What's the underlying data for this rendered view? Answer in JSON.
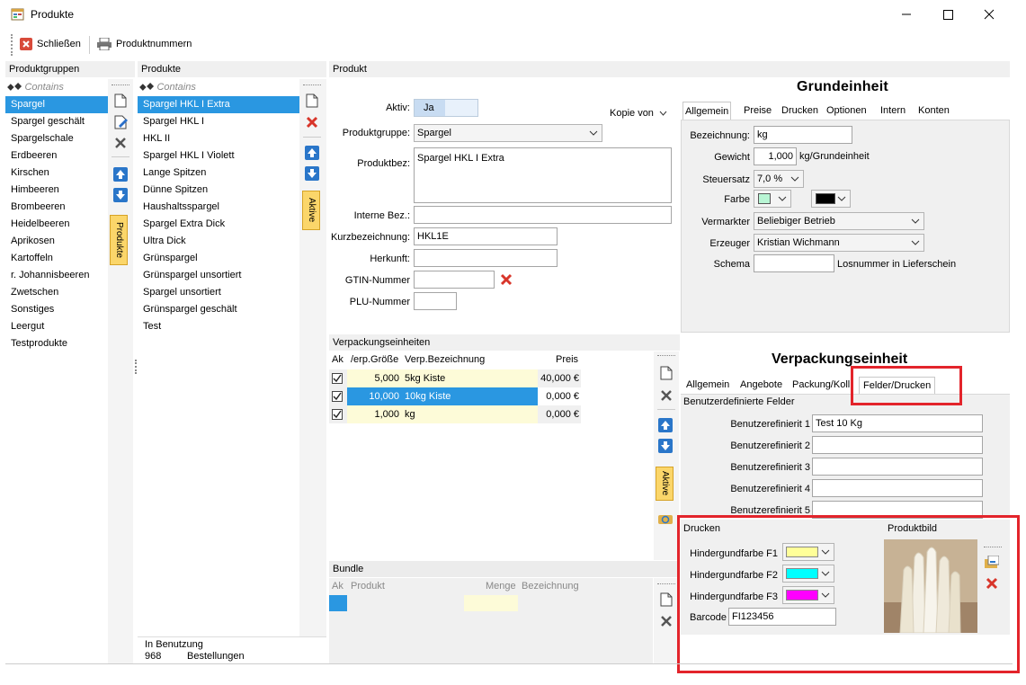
{
  "window": {
    "title": "Produkte"
  },
  "toolbar": {
    "close_label": "Schließen",
    "numbers_label": "Produktnummern"
  },
  "panels": {
    "groups": "Produktgruppen",
    "products": "Produkte",
    "product": "Produkt",
    "packaging": "Verpackungseinheiten",
    "bundle": "Bundle"
  },
  "filter": {
    "contains": "Contains"
  },
  "groups": [
    "Spargel",
    "Spargel geschält",
    "Spargelschale",
    "Erdbeeren",
    "Kirschen",
    "Himbeeren",
    "Brombeeren",
    "Heidelbeeren",
    "Aprikosen",
    "Kartoffeln",
    "r. Johannisbeeren",
    "Zwetschen",
    "Sonstiges",
    "Leergut",
    "Testprodukte"
  ],
  "products": [
    "Spargel HKL I Extra",
    "Spargel HKL I",
    "HKL II",
    "Spargel HKL I Violett",
    "Lange Spitzen",
    "Dünne Spitzen",
    "Haushaltsspargel",
    "Spargel Extra Dick",
    "Ultra Dick",
    "Grünspargel",
    "Grünspargel unsortiert",
    "Spargel unsortiert",
    "Grünspargel geschält",
    "Test"
  ],
  "side_tabs": {
    "produkte": "Produkte",
    "aktive": "Aktive",
    "aktive2": "Aktive"
  },
  "usage": {
    "label": "In Benutzung",
    "count": "968",
    "what": "Bestellungen"
  },
  "form": {
    "aktiv_label": "Aktiv:",
    "aktiv_value": "Ja",
    "kopie_label": "Kopie von",
    "gruppe_label": "Produktgruppe:",
    "gruppe_value": "Spargel",
    "bez_label": "Produktbez:",
    "bez_value": "Spargel HKL I Extra",
    "intern_label": "Interne Bez.:",
    "intern_value": "",
    "kurz_label": "Kurzbezeichnung:",
    "kurz_value": "HKL1E",
    "herkunft_label": "Herkunft:",
    "herkunft_value": "",
    "gtin_label": "GTIN-Nummer",
    "gtin_value": "",
    "plu_label": "PLU-Nummer",
    "plu_value": ""
  },
  "grund": {
    "title": "Grundeinheit",
    "tabs": [
      "Allgemein",
      "Preise",
      "Drucken",
      "Optionen",
      "Intern",
      "Konten"
    ],
    "bez_label": "Bezeichnung:",
    "bez_value": "kg",
    "gewicht_label": "Gewicht",
    "gewicht_value": "1,000",
    "gewicht_unit": "kg/Grundeinheit",
    "steuer_label": "Steuersatz",
    "steuer_value": "7,0 %",
    "farbe_label": "Farbe",
    "farbe_color": "#b8f5d4",
    "farbe2_color": "#000000",
    "vermarkter_label": "Vermarkter",
    "vermarkter_value": "Beliebiger Betrieb",
    "erzeuger_label": "Erzeuger",
    "erzeuger_value": "Kristian Wichmann",
    "schema_label": "Schema",
    "schema_value": "",
    "schema_note": "Losnummer in Lieferschein"
  },
  "pack": {
    "columns": [
      "Ak",
      "/erp.Größe",
      "Verp.Bezeichnung",
      "Preis"
    ],
    "rows": [
      {
        "size": "5,000",
        "name": "5kg Kiste",
        "price": "40,000 €"
      },
      {
        "size": "10,000",
        "name": "10kg Kiste",
        "price": "0,000 €"
      },
      {
        "size": "1,000",
        "name": "kg",
        "price": "0,000 €"
      }
    ]
  },
  "verp": {
    "title": "Verpackungseinheit",
    "tabs": [
      "Allgemein",
      "Angebote",
      "Packung/Kolli",
      "Felder/Drucken"
    ],
    "section": "Benutzerdefinierte Felder",
    "fields": [
      {
        "label": "Benutzerefinierit 1",
        "value": "Test 10 Kg"
      },
      {
        "label": "Benutzerefinierit 2",
        "value": ""
      },
      {
        "label": "Benutzerefinierit 3",
        "value": ""
      },
      {
        "label": "Benutzerefinierit 4",
        "value": ""
      },
      {
        "label": "Benutzerefinierit 5",
        "value": ""
      }
    ],
    "drucken": "Drucken",
    "produktbild": "Produktbild",
    "hg1_label": "Hindergundfarbe F1",
    "hg1_color": "#ffff99",
    "hg2_label": "Hindergundfarbe F2",
    "hg2_color": "#00ffff",
    "hg3_label": "Hindergundfarbe F3",
    "hg3_color": "#ff00ff",
    "barcode_label": "Barcode",
    "barcode_value": "FI123456"
  },
  "bundle": {
    "columns": [
      "Ak",
      "Produkt",
      "Menge",
      "Bezeichnung"
    ]
  },
  "colors": {
    "accent": "#2a97e1",
    "highlight": "#e3242b",
    "orange": "#fbd66a"
  }
}
